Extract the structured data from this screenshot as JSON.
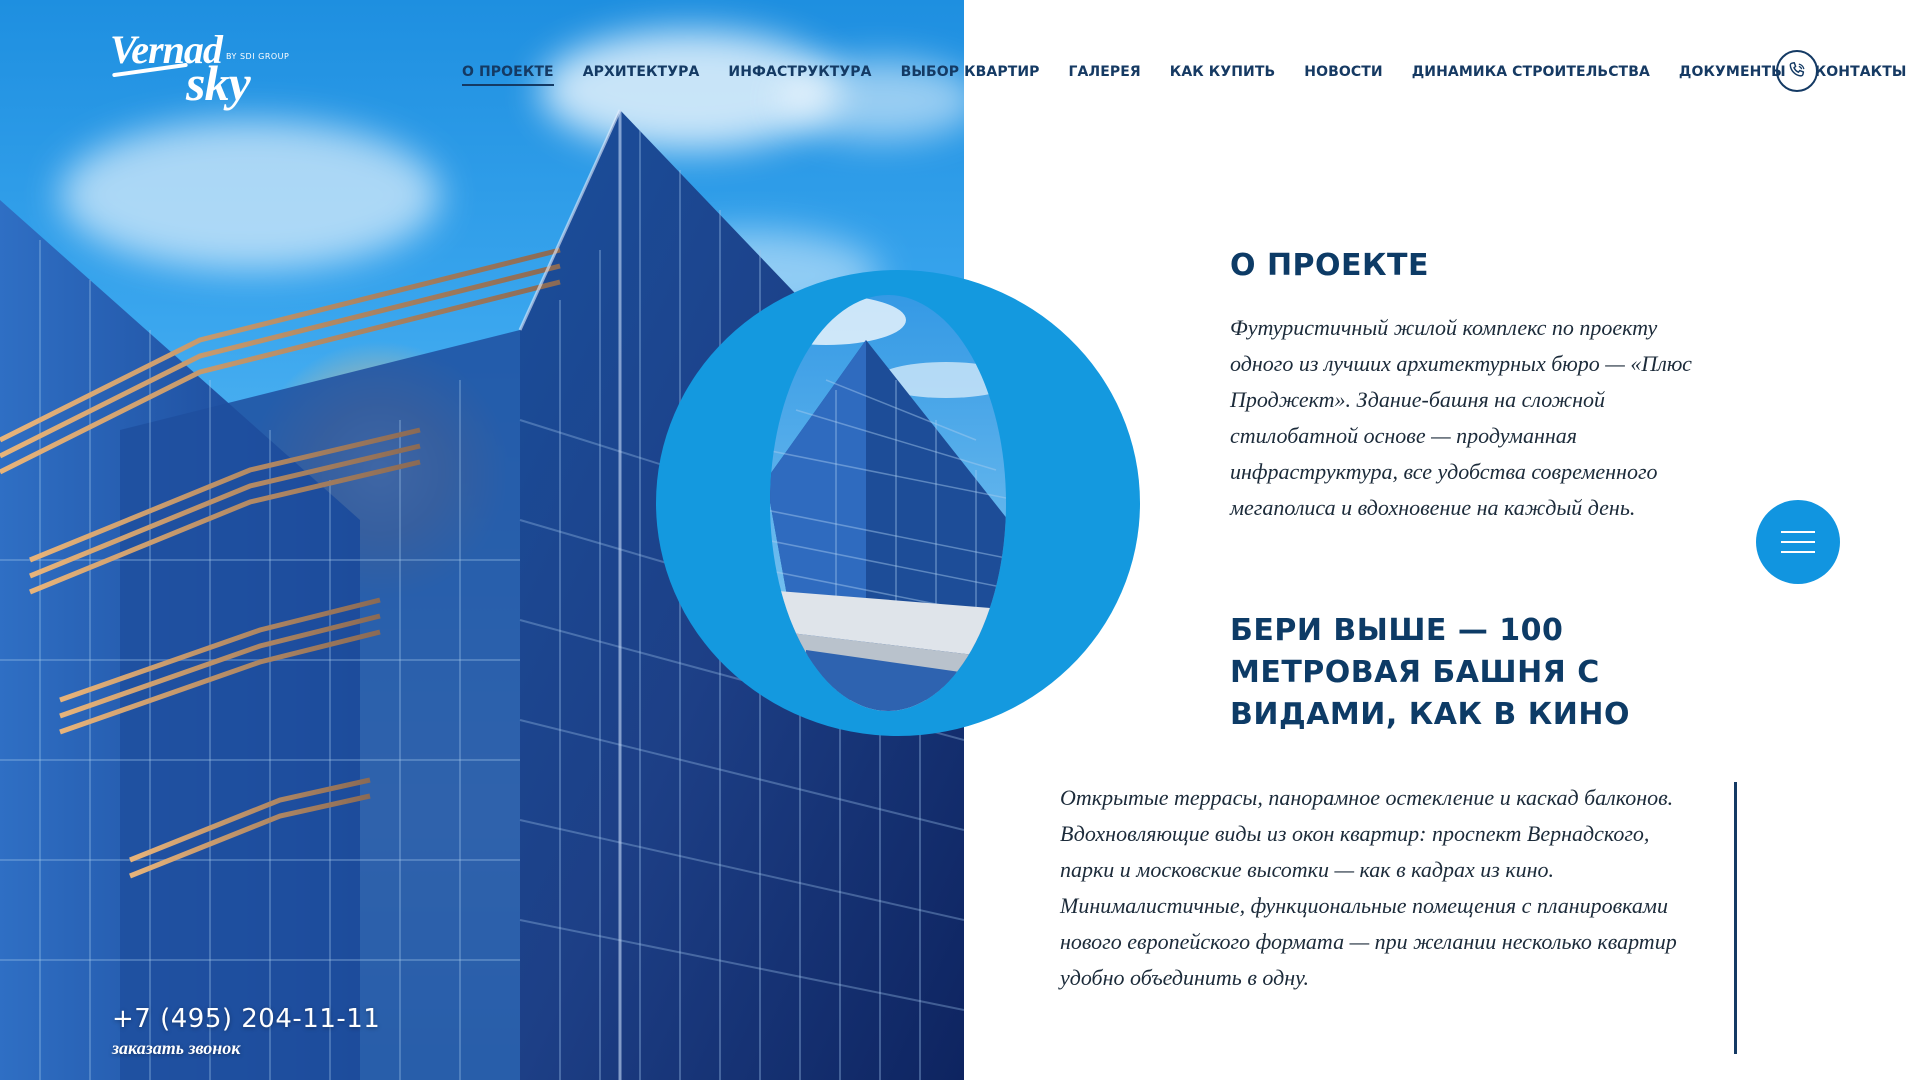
{
  "brand": {
    "logo_line1": "Vernad",
    "logo_line2": "sky",
    "logo_by": "BY SDI GROUP"
  },
  "nav": {
    "items": [
      {
        "label": "О ПРОЕКТЕ",
        "active": true
      },
      {
        "label": "АРХИТЕКТУРА",
        "active": false
      },
      {
        "label": "ИНФАСТРУКТУРА",
        "active": false
      },
      {
        "label": "ВЫБОР КВАРТИР",
        "active": false
      },
      {
        "label": "ГАЛЕРЕЯ",
        "active": false
      },
      {
        "label": "КАК КУПИТЬ",
        "active": false
      },
      {
        "label": "НОВОСТИ",
        "active": false
      },
      {
        "label": "ДИНАМИКА СТРОИТЕЛЬСТВА",
        "active": false
      },
      {
        "label": "ДОКУМЕНТЫ",
        "active": false
      },
      {
        "label": "КОНТАКТЫ",
        "active": false
      }
    ],
    "call_icon": "phone-icon"
  },
  "hero": {
    "phone": "+7 (495) 204-11-11",
    "callback_label": "заказать звонок"
  },
  "about": {
    "title": "О ПРОЕКТЕ",
    "intro": "Футуристичный жилой комплекс по проекту одного из лучших архитектурных бюро — «Плюс Проджект». Здание-башня на сложной стилобатной основе — продуманная инфраструктура, все удобства современного мегаполиса и вдохновение на каждый день.",
    "headline": "БЕРИ ВЫШЕ — 100 МЕТРОВАЯ БАШНЯ С ВИДАМИ, КАК В КИНО",
    "body_p1": "Открытые террасы, панорамное остекление и каскад балконов. Вдохновляющие виды из окон квартир: проспект Вернадского, парки и московские высотки — как в кадрах из кино.",
    "body_p2": "Минималистичные, функциональные помещения с планировками нового европейского формата — при желании несколько квартир удобно объединить в одну."
  },
  "menu_button": {
    "icon": "burger-menu-icon"
  },
  "colors": {
    "accent_blue": "#1195e0",
    "dark_blue": "#0d3b66",
    "text": "#1c2b3a"
  }
}
